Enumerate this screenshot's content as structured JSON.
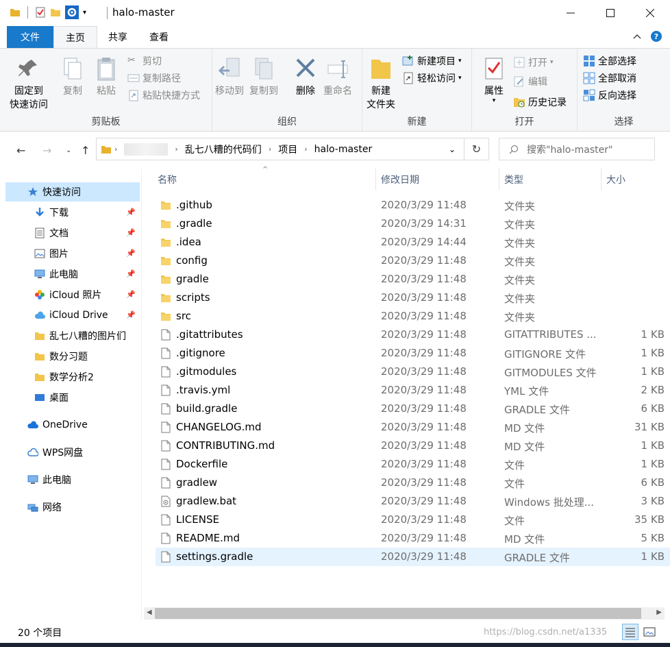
{
  "window": {
    "title": "halo-master"
  },
  "tabs": [
    {
      "label": "文件"
    },
    {
      "label": "主页"
    },
    {
      "label": "共享"
    },
    {
      "label": "查看"
    }
  ],
  "ribbon": {
    "clipboard": {
      "label": "剪贴板",
      "pin": "固定到快速访问",
      "pin_line1": "固定到",
      "pin_line2": "快速访问",
      "copy": "复制",
      "paste": "粘贴",
      "cut": "剪切",
      "copy_path": "复制路径",
      "paste_shortcut": "粘贴快捷方式"
    },
    "organize": {
      "label": "组织",
      "move_to": "移动到",
      "copy_to": "复制到",
      "delete": "删除",
      "rename": "重命名"
    },
    "new": {
      "label": "新建",
      "new_folder_line1": "新建",
      "new_folder_line2": "文件夹",
      "new_item": "新建项目",
      "easy_access": "轻松访问"
    },
    "open": {
      "label": "打开",
      "properties": "属性",
      "open": "打开",
      "edit": "编辑",
      "history": "历史记录"
    },
    "select": {
      "label": "选择",
      "select_all": "全部选择",
      "select_none": "全部取消",
      "invert": "反向选择"
    }
  },
  "address": {
    "crumbs": [
      "乱七八糟的代码们",
      "项目",
      "halo-master"
    ]
  },
  "search": {
    "placeholder": "搜索\"halo-master\""
  },
  "nav": {
    "items": [
      {
        "label": "快速访问"
      },
      {
        "label": "下载"
      },
      {
        "label": "文档"
      },
      {
        "label": "图片"
      },
      {
        "label": "此电脑"
      },
      {
        "label": "iCloud 照片"
      },
      {
        "label": "iCloud Drive"
      },
      {
        "label": "乱七八糟的图片们"
      },
      {
        "label": "数分习题"
      },
      {
        "label": "数学分析2"
      },
      {
        "label": "桌面"
      },
      {
        "label": "OneDrive"
      },
      {
        "label": "WPS网盘"
      },
      {
        "label": "此电脑"
      },
      {
        "label": "网络"
      }
    ]
  },
  "columns": {
    "name": "名称",
    "date": "修改日期",
    "type": "类型",
    "size": "大小"
  },
  "files": [
    {
      "name": ".github",
      "date": "2020/3/29 11:48",
      "type": "文件夹",
      "size": ""
    },
    {
      "name": ".gradle",
      "date": "2020/3/29 14:31",
      "type": "文件夹",
      "size": ""
    },
    {
      "name": ".idea",
      "date": "2020/3/29 14:44",
      "type": "文件夹",
      "size": ""
    },
    {
      "name": "config",
      "date": "2020/3/29 11:48",
      "type": "文件夹",
      "size": ""
    },
    {
      "name": "gradle",
      "date": "2020/3/29 11:48",
      "type": "文件夹",
      "size": ""
    },
    {
      "name": "scripts",
      "date": "2020/3/29 11:48",
      "type": "文件夹",
      "size": ""
    },
    {
      "name": "src",
      "date": "2020/3/29 11:48",
      "type": "文件夹",
      "size": ""
    },
    {
      "name": ".gitattributes",
      "date": "2020/3/29 11:48",
      "type": "GITATTRIBUTES ...",
      "size": "1 KB"
    },
    {
      "name": ".gitignore",
      "date": "2020/3/29 11:48",
      "type": "GITIGNORE 文件",
      "size": "1 KB"
    },
    {
      "name": ".gitmodules",
      "date": "2020/3/29 11:48",
      "type": "GITMODULES 文件",
      "size": "1 KB"
    },
    {
      "name": ".travis.yml",
      "date": "2020/3/29 11:48",
      "type": "YML 文件",
      "size": "2 KB"
    },
    {
      "name": "build.gradle",
      "date": "2020/3/29 11:48",
      "type": "GRADLE 文件",
      "size": "6 KB"
    },
    {
      "name": "CHANGELOG.md",
      "date": "2020/3/29 11:48",
      "type": "MD 文件",
      "size": "31 KB"
    },
    {
      "name": "CONTRIBUTING.md",
      "date": "2020/3/29 11:48",
      "type": "MD 文件",
      "size": "1 KB"
    },
    {
      "name": "Dockerfile",
      "date": "2020/3/29 11:48",
      "type": "文件",
      "size": "1 KB"
    },
    {
      "name": "gradlew",
      "date": "2020/3/29 11:48",
      "type": "文件",
      "size": "6 KB"
    },
    {
      "name": "gradlew.bat",
      "date": "2020/3/29 11:48",
      "type": "Windows 批处理...",
      "size": "3 KB"
    },
    {
      "name": "LICENSE",
      "date": "2020/3/29 11:48",
      "type": "文件",
      "size": "35 KB"
    },
    {
      "name": "README.md",
      "date": "2020/3/29 11:48",
      "type": "MD 文件",
      "size": "5 KB"
    },
    {
      "name": "settings.gradle",
      "date": "2020/3/29 11:48",
      "type": "GRADLE 文件",
      "size": "1 KB"
    }
  ],
  "status": {
    "count": "20 个项目"
  },
  "watermark": "https://blog.csdn.net/a1335"
}
